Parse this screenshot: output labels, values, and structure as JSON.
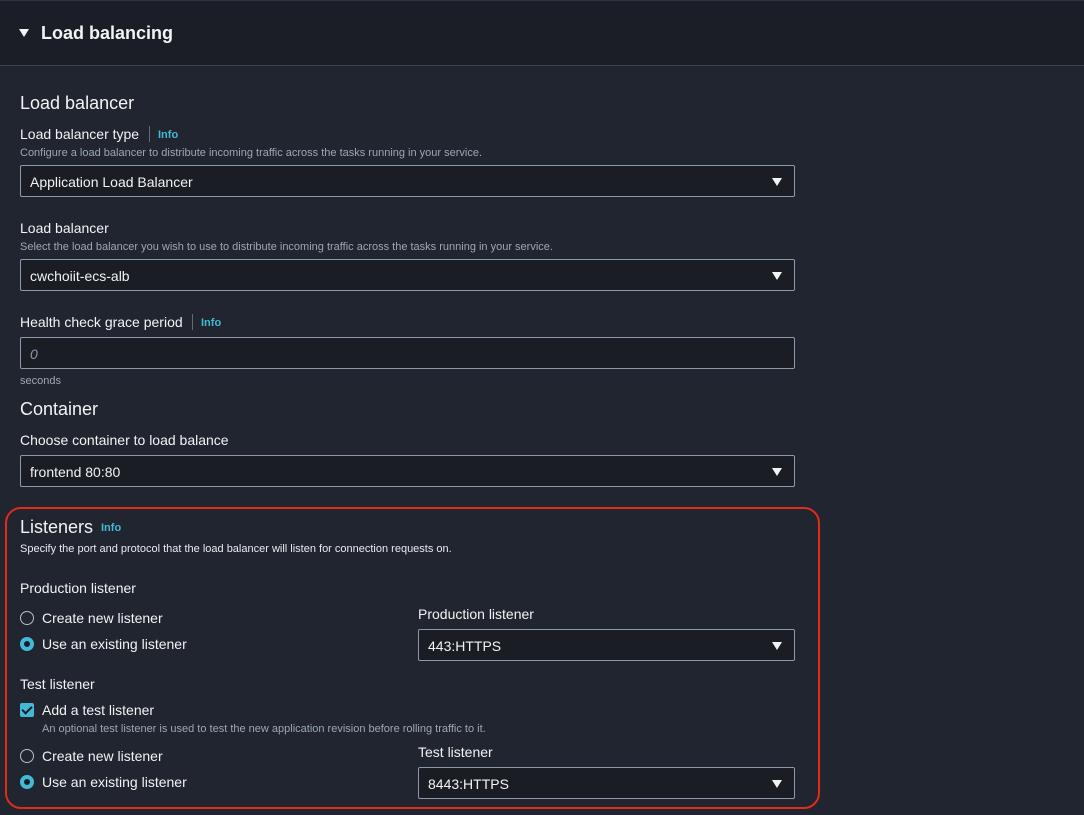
{
  "section": {
    "title": "Load balancing"
  },
  "load_balancer": {
    "heading": "Load balancer",
    "type_label": "Load balancer type",
    "type_info": "Info",
    "type_desc": "Configure a load balancer to distribute incoming traffic across the tasks running in your service.",
    "type_value": "Application Load Balancer",
    "lb_label": "Load balancer",
    "lb_desc": "Select the load balancer you wish to use to distribute incoming traffic across the tasks running in your service.",
    "lb_value": "cwchoiit-ecs-alb",
    "grace_label": "Health check grace period",
    "grace_info": "Info",
    "grace_placeholder": "0",
    "grace_unit": "seconds"
  },
  "container": {
    "heading": "Container",
    "choose_label": "Choose container to load balance",
    "value": "frontend 80:80"
  },
  "listeners": {
    "heading": "Listeners",
    "info": "Info",
    "desc": "Specify the port and protocol that the load balancer will listen for connection requests on.",
    "production": {
      "label": "Production listener",
      "option_new": "Create new listener",
      "option_existing": "Use an existing listener",
      "selected": "existing",
      "select_label": "Production listener",
      "select_value": "443:HTTPS"
    },
    "test": {
      "label": "Test listener",
      "checkbox_label": "Add a test listener",
      "checkbox_checked": true,
      "checkbox_desc": "An optional test listener is used to test the new application revision before rolling traffic to it.",
      "option_new": "Create new listener",
      "option_existing": "Use an existing listener",
      "selected": "existing",
      "select_label": "Test listener",
      "select_value": "8443:HTTPS"
    }
  },
  "colors": {
    "background": "#212530",
    "accent": "#44b9d6",
    "highlight": "#e22b1a"
  }
}
